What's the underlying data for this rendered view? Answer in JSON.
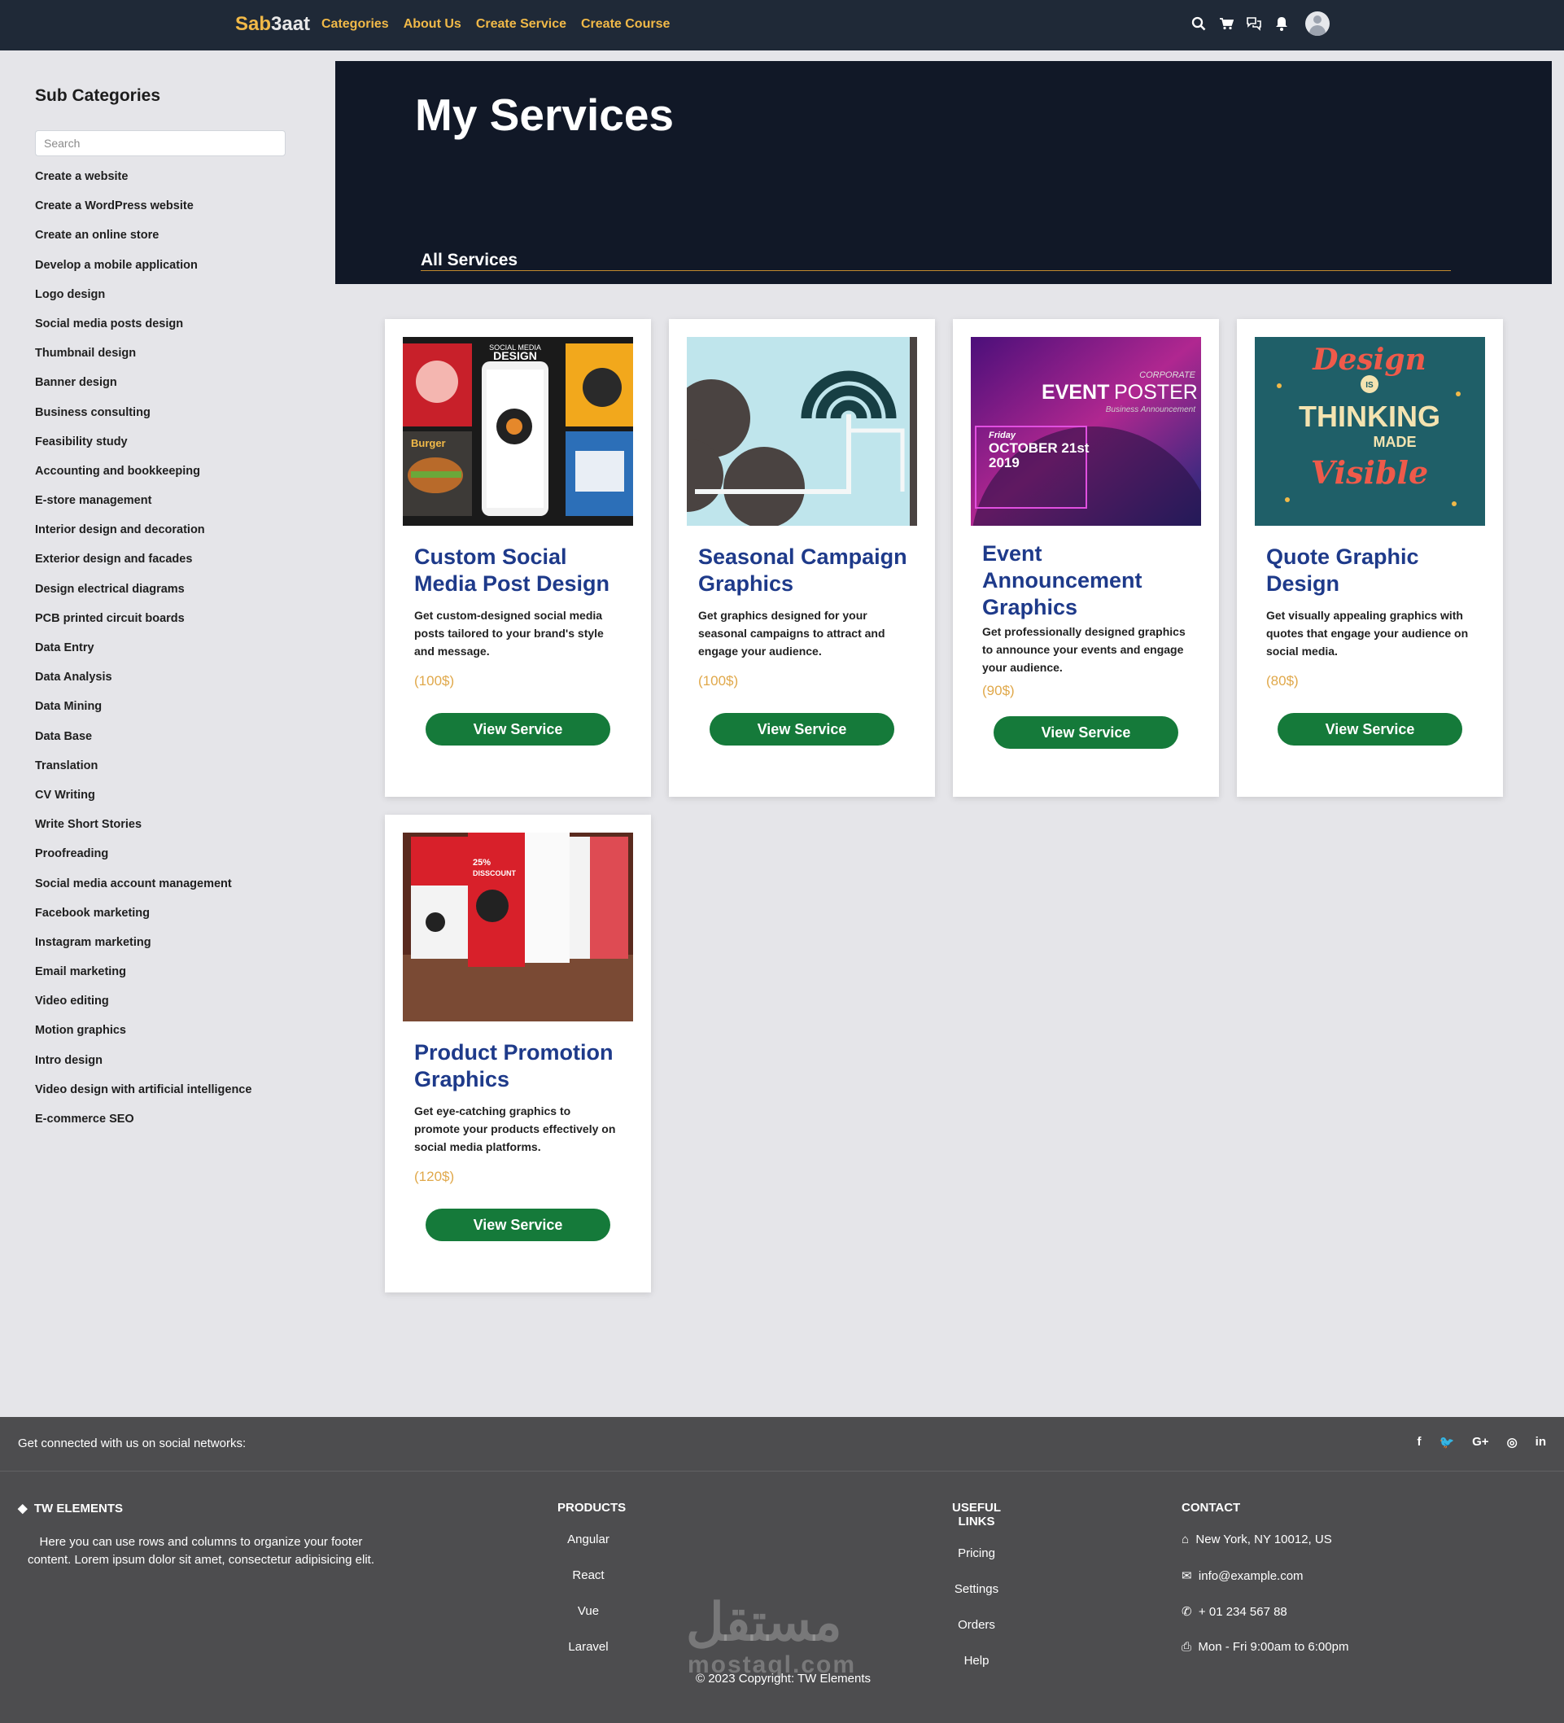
{
  "nav": {
    "brand_a": "Sab",
    "brand_b": "3aat",
    "links": [
      "Categories",
      "About Us",
      "Create Service",
      "Create Course"
    ]
  },
  "sidebar": {
    "title": "Sub Categories",
    "search_placeholder": "Search",
    "items": [
      "Create a website",
      "Create a WordPress website",
      "Create an online store",
      "Develop a mobile application",
      "Logo design",
      "Social media posts design",
      "Thumbnail design",
      "Banner design",
      "Business consulting",
      "Feasibility study",
      "Accounting and bookkeeping",
      "E-store management",
      "Interior design and decoration",
      "Exterior design and facades",
      "Design electrical diagrams",
      "PCB printed circuit boards",
      "Data Entry",
      "Data Analysis",
      "Data Mining",
      "Data Base",
      "Translation",
      "CV Writing",
      "Write Short Stories",
      "Proofreading",
      "Social media account management",
      "Facebook marketing",
      "Instagram marketing",
      "Email marketing",
      "Video editing",
      "Motion graphics",
      "Intro design",
      "Video design with artificial intelligence",
      "E-commerce SEO"
    ]
  },
  "hero": {
    "title": "My Services",
    "tab": "All Services"
  },
  "cards": [
    {
      "title": "Custom Social Media Post Design",
      "desc": "Get custom-designed social media posts tailored to your brand's style and message.",
      "price": "(100$)",
      "button": "View Service",
      "image_text": [
        "SOCIAL MEDIA",
        "DESIGN",
        "Burger"
      ]
    },
    {
      "title": "Seasonal Campaign Graphics",
      "desc": "Get graphics designed for your seasonal campaigns to attract and engage your audience.",
      "price": "(100$)",
      "button": "View Service"
    },
    {
      "title": "Event Announcement Graphics",
      "desc": "Get professionally designed graphics to announce your events and engage your audience.",
      "price": "(90$)",
      "button": "View Service",
      "image_text": [
        "CORPORATE",
        "EVENT",
        "POSTER",
        "Business Announcement",
        "Friday",
        "OCTOBER 21st",
        "2019"
      ]
    },
    {
      "title": "Quote Graphic Design",
      "desc": "Get visually appealing graphics with quotes that engage your audience on social media.",
      "price": "(80$)",
      "button": "View Service",
      "image_text": [
        "Design",
        "IS",
        "THINKING",
        "MADE",
        "Visible"
      ]
    },
    {
      "title": "Product Promotion Graphics",
      "desc": "Get eye-catching graphics to promote your products effectively on social media platforms.",
      "price": "(120$)",
      "button": "View Service",
      "image_text": [
        "25%",
        "DISSCOUNT"
      ]
    }
  ],
  "footer": {
    "connect": "Get connected with us on social networks:",
    "socials": [
      "f",
      "🐦",
      "G+",
      "◎",
      "in"
    ],
    "brand_head": "TW ELEMENTS",
    "brand_text": "Here you can use rows and columns to organize your footer content. Lorem ipsum dolor sit amet, consectetur adipisicing elit.",
    "products_head": "PRODUCTS",
    "products": [
      "Angular",
      "React",
      "Vue",
      "Laravel"
    ],
    "links_head": "USEFUL LINKS",
    "links": [
      "Pricing",
      "Settings",
      "Orders",
      "Help"
    ],
    "contact_head": "CONTACT",
    "contact": [
      "New York, NY 10012, US",
      "info@example.com",
      "+ 01 234 567 88",
      "Mon - Fri 9:00am to 6:00pm"
    ],
    "copyright": "© 2023 Copyright: TW Elements",
    "watermark": "مستقل",
    "watermark_latin": "mostaql.com"
  }
}
